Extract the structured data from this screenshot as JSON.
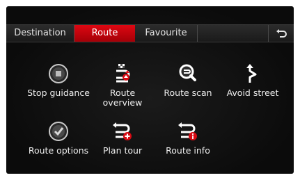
{
  "tabs": [
    {
      "label": "Destination",
      "active": false
    },
    {
      "label": "Route",
      "active": true
    },
    {
      "label": "Favourite",
      "active": false
    }
  ],
  "colors": {
    "accent": "#d10510",
    "background": "#0e0e0e",
    "text": "#e9e9e9"
  },
  "menu": [
    {
      "label": "Stop guidance",
      "icon": "stop-guidance-icon"
    },
    {
      "label": "Route overview",
      "icon": "route-overview-icon"
    },
    {
      "label": "Route scan",
      "icon": "route-scan-icon"
    },
    {
      "label": "Avoid street",
      "icon": "avoid-street-icon"
    },
    {
      "label": "Route options",
      "icon": "route-options-icon"
    },
    {
      "label": "Plan tour",
      "icon": "plan-tour-icon"
    },
    {
      "label": "Route info",
      "icon": "route-info-icon"
    }
  ]
}
